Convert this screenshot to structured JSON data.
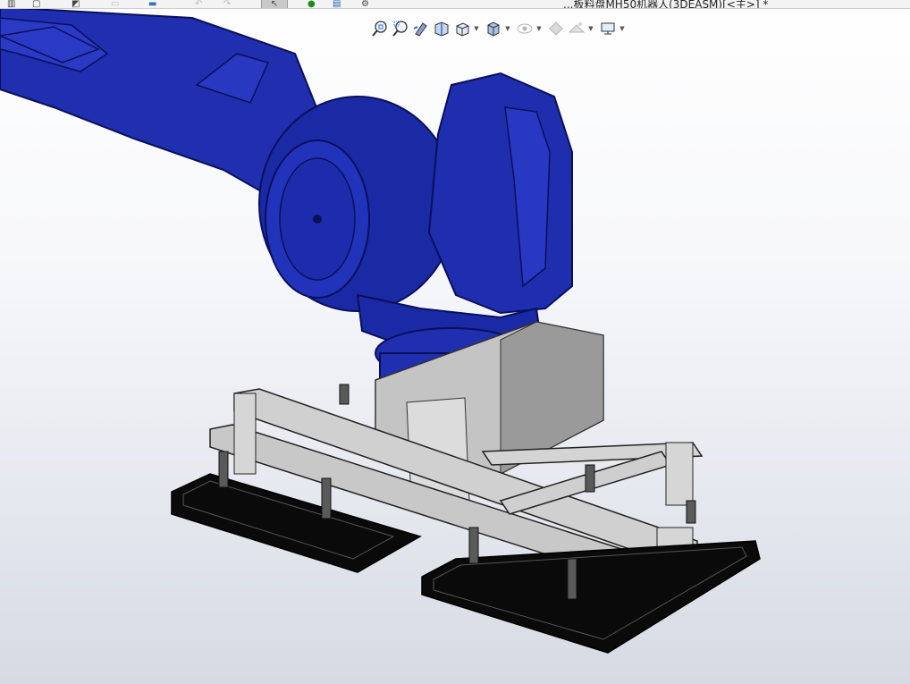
{
  "window": {
    "title": "...板料盘MH50机器人(3DEASM)[<主>] *"
  },
  "top_toolbar": {
    "icons": [
      "grid-icon",
      "new-document-icon",
      "sketch-icon",
      "disabled-icon",
      "print-icon",
      "undo-icon",
      "redo-icon",
      "select-arrow-icon",
      "rebuild-icon",
      "file-properties-icon",
      "options-gear-icon"
    ],
    "active": "select-arrow-icon"
  },
  "heads_up_toolbar": {
    "items": [
      {
        "name": "zoom-to-fit-icon",
        "dropdown": false
      },
      {
        "name": "zoom-to-area-icon",
        "dropdown": false
      },
      {
        "name": "previous-view-icon",
        "dropdown": false
      },
      {
        "name": "section-view-icon",
        "dropdown": false
      },
      {
        "name": "view-orientation-icon",
        "dropdown": true
      },
      {
        "name": "display-style-icon",
        "dropdown": true
      },
      {
        "name": "hide-show-items-icon",
        "dropdown": true,
        "disabled": true
      },
      {
        "name": "edit-appearance-icon",
        "dropdown": false,
        "disabled": true
      },
      {
        "name": "apply-scene-icon",
        "dropdown": true,
        "disabled": true
      },
      {
        "name": "view-settings-icon",
        "dropdown": true
      }
    ]
  },
  "scene": {
    "description_visible": false,
    "colors": {
      "robot_blue": "#1f2fb0",
      "robot_dark": "#0d1570",
      "frame_gray": "#c9c9c9",
      "pad_black": "#0a0a0a",
      "box_gray": "#c4c4c4"
    }
  }
}
